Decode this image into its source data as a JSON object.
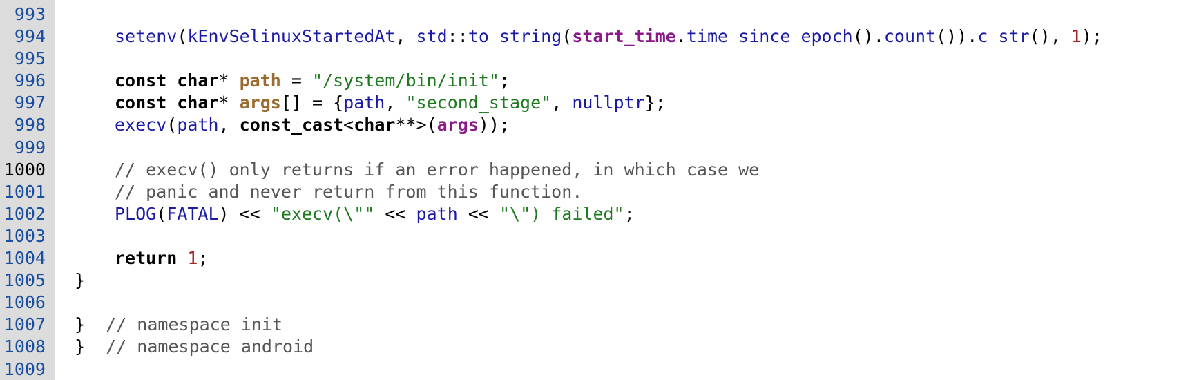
{
  "lines": [
    {
      "num": "993",
      "tokens": []
    },
    {
      "num": "994",
      "indent": "    ",
      "tokens": [
        {
          "t": "setenv",
          "k": "fn"
        },
        {
          "t": "(",
          "k": "op"
        },
        {
          "t": "kEnvSelinuxStartedAt",
          "k": "id"
        },
        {
          "t": ", ",
          "k": "op"
        },
        {
          "t": "std",
          "k": "id"
        },
        {
          "t": "::",
          "k": "op"
        },
        {
          "t": "to_string",
          "k": "fn"
        },
        {
          "t": "(",
          "k": "op"
        },
        {
          "t": "start_time",
          "k": "param"
        },
        {
          "t": ".",
          "k": "op"
        },
        {
          "t": "time_since_epoch",
          "k": "fn"
        },
        {
          "t": "().",
          "k": "op"
        },
        {
          "t": "count",
          "k": "fn"
        },
        {
          "t": "()).",
          "k": "op"
        },
        {
          "t": "c_str",
          "k": "fn"
        },
        {
          "t": "(), ",
          "k": "op"
        },
        {
          "t": "1",
          "k": "num"
        },
        {
          "t": ");",
          "k": "op"
        }
      ]
    },
    {
      "num": "995",
      "tokens": []
    },
    {
      "num": "996",
      "indent": "    ",
      "tokens": [
        {
          "t": "const char",
          "k": "kw"
        },
        {
          "t": "* ",
          "k": "op"
        },
        {
          "t": "path",
          "k": "var"
        },
        {
          "t": " = ",
          "k": "op"
        },
        {
          "t": "\"/system/bin/init\"",
          "k": "str"
        },
        {
          "t": ";",
          "k": "op"
        }
      ]
    },
    {
      "num": "997",
      "indent": "    ",
      "tokens": [
        {
          "t": "const char",
          "k": "kw"
        },
        {
          "t": "* ",
          "k": "op"
        },
        {
          "t": "args",
          "k": "var"
        },
        {
          "t": "[] = {",
          "k": "op"
        },
        {
          "t": "path",
          "k": "id"
        },
        {
          "t": ", ",
          "k": "op"
        },
        {
          "t": "\"second_stage\"",
          "k": "str"
        },
        {
          "t": ", ",
          "k": "op"
        },
        {
          "t": "nullptr",
          "k": "id"
        },
        {
          "t": "};",
          "k": "op"
        }
      ]
    },
    {
      "num": "998",
      "indent": "    ",
      "tokens": [
        {
          "t": "execv",
          "k": "fn"
        },
        {
          "t": "(",
          "k": "op"
        },
        {
          "t": "path",
          "k": "id"
        },
        {
          "t": ", ",
          "k": "op"
        },
        {
          "t": "const_cast",
          "k": "kw"
        },
        {
          "t": "<",
          "k": "op"
        },
        {
          "t": "char",
          "k": "kw"
        },
        {
          "t": "**>(",
          "k": "op"
        },
        {
          "t": "args",
          "k": "param"
        },
        {
          "t": "));",
          "k": "op"
        }
      ]
    },
    {
      "num": "999",
      "tokens": []
    },
    {
      "num": "1000",
      "current": true,
      "indent": "    ",
      "tokens": [
        {
          "t": "// execv() only returns if an error happened, in which case we",
          "k": "com"
        }
      ]
    },
    {
      "num": "1001",
      "indent": "    ",
      "tokens": [
        {
          "t": "// panic and never return from this function.",
          "k": "com"
        }
      ]
    },
    {
      "num": "1002",
      "indent": "    ",
      "tokens": [
        {
          "t": "PLOG",
          "k": "fn"
        },
        {
          "t": "(",
          "k": "op"
        },
        {
          "t": "FATAL",
          "k": "id"
        },
        {
          "t": ") << ",
          "k": "op"
        },
        {
          "t": "\"execv(\\\"\"",
          "k": "str"
        },
        {
          "t": " << ",
          "k": "op"
        },
        {
          "t": "path",
          "k": "id"
        },
        {
          "t": " << ",
          "k": "op"
        },
        {
          "t": "\"\\\") failed\"",
          "k": "str"
        },
        {
          "t": ";",
          "k": "op"
        }
      ]
    },
    {
      "num": "1003",
      "tokens": []
    },
    {
      "num": "1004",
      "indent": "    ",
      "tokens": [
        {
          "t": "return",
          "k": "kw"
        },
        {
          "t": " ",
          "k": "op"
        },
        {
          "t": "1",
          "k": "num"
        },
        {
          "t": ";",
          "k": "op"
        }
      ]
    },
    {
      "num": "1005",
      "indent": "",
      "tokens": [
        {
          "t": "}",
          "k": "op"
        }
      ]
    },
    {
      "num": "1006",
      "tokens": []
    },
    {
      "num": "1007",
      "indent": "",
      "tokens": [
        {
          "t": "}  ",
          "k": "op"
        },
        {
          "t": "// namespace init",
          "k": "com"
        }
      ]
    },
    {
      "num": "1008",
      "indent": "",
      "tokens": [
        {
          "t": "}  ",
          "k": "op"
        },
        {
          "t": "// namespace android",
          "k": "com"
        }
      ]
    },
    {
      "num": "1009",
      "tokens": []
    }
  ]
}
